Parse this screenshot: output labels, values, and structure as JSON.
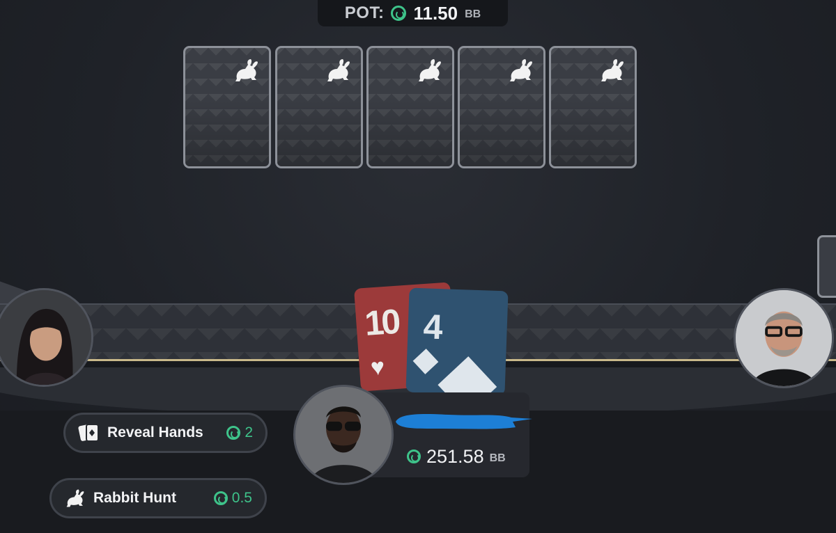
{
  "pot": {
    "label": "POT:",
    "value": "11.50",
    "unit": "BB"
  },
  "board": {
    "cards": [
      {
        "state": "face-down",
        "icon": "rabbit-icon"
      },
      {
        "state": "face-down",
        "icon": "rabbit-icon"
      },
      {
        "state": "face-down",
        "icon": "rabbit-icon"
      },
      {
        "state": "face-down",
        "icon": "rabbit-icon"
      },
      {
        "state": "face-down",
        "icon": "rabbit-icon"
      }
    ]
  },
  "hero": {
    "hole_cards": [
      {
        "rank": "10",
        "suit": "hearts",
        "suit_glyph": "♥",
        "color": "#9c3a3a"
      },
      {
        "rank": "4",
        "suit": "diamonds",
        "color": "#2f5270"
      }
    ],
    "stack": "251.58",
    "stack_unit": "BB"
  },
  "actions": {
    "reveal_hands": {
      "label": "Reveal Hands",
      "cost": "2"
    },
    "rabbit_hunt": {
      "label": "Rabbit Hunt",
      "cost": "0.5"
    }
  },
  "colors": {
    "accent": "#3ec38a",
    "background": "#1f2228",
    "card_back": "#3a3d44",
    "redaction": "#1d7fd6"
  }
}
